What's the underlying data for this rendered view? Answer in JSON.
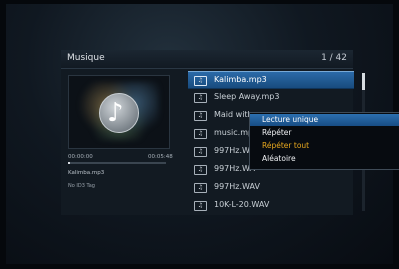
{
  "header": {
    "title": "Musique",
    "page_count": "1 / 42"
  },
  "player": {
    "time_start": "00:00:00",
    "time_end": "00:05:48",
    "progress_percent": 2,
    "now_playing": "Kalimba.mp3",
    "tag_info": "No ID3 Tag"
  },
  "files": [
    {
      "name": "Kalimba.mp3",
      "icon": "music-file-icon"
    },
    {
      "name": "Sleep Away.mp3",
      "icon": "music-file-icon"
    },
    {
      "name": "Maid with",
      "icon": "music-file-icon"
    },
    {
      "name": "music.mp3",
      "icon": "music-file-icon"
    },
    {
      "name": "997Hz.WA",
      "icon": "music-file-icon"
    },
    {
      "name": "997Hz.WA",
      "icon": "music-file-icon"
    },
    {
      "name": "997Hz.WAV",
      "icon": "music-file-icon"
    },
    {
      "name": "10K-L-20.WAV",
      "icon": "music-file-icon"
    }
  ],
  "context_menu": {
    "items": [
      "Lecture unique",
      "Répéter",
      "Répéter tout",
      "Aléatoire"
    ]
  },
  "colors": {
    "selection": "#2b6aa8",
    "current_option": "#e9a91e"
  }
}
